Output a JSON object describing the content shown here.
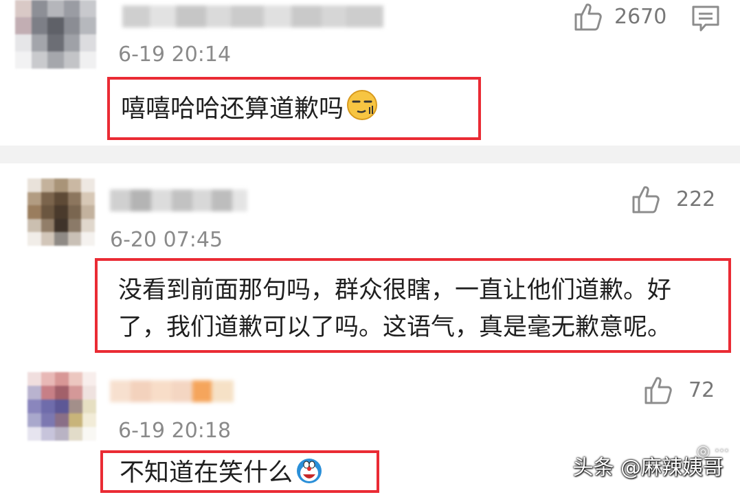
{
  "comments": [
    {
      "timestamp": "6-19 20:14",
      "likes": "2670",
      "text": "嘻嘻哈哈还算道歉吗",
      "emoji": "smirk-face-emoji"
    },
    {
      "timestamp": "6-20 07:45",
      "likes": "222",
      "text_line1": "没看到前面那句吗，群众很瞎，一直让他们道歉。好",
      "text_line2": "了，我们道歉可以了吗。这语气，真是毫无歉意呢。"
    },
    {
      "timestamp": "6-19 20:18",
      "likes": "72",
      "text": "不知道在笑什么",
      "emoji": "doraemon-emoji"
    }
  ],
  "watermark": {
    "text": "头条 @麻辣姨哥"
  },
  "icons": {
    "like": "thumbs-up-icon",
    "reply": "comment-bubble-icon"
  },
  "colors": {
    "highlight_border": "#ea2b34",
    "timestamp": "#8a8a8a",
    "divider": "#f2f2f2"
  }
}
